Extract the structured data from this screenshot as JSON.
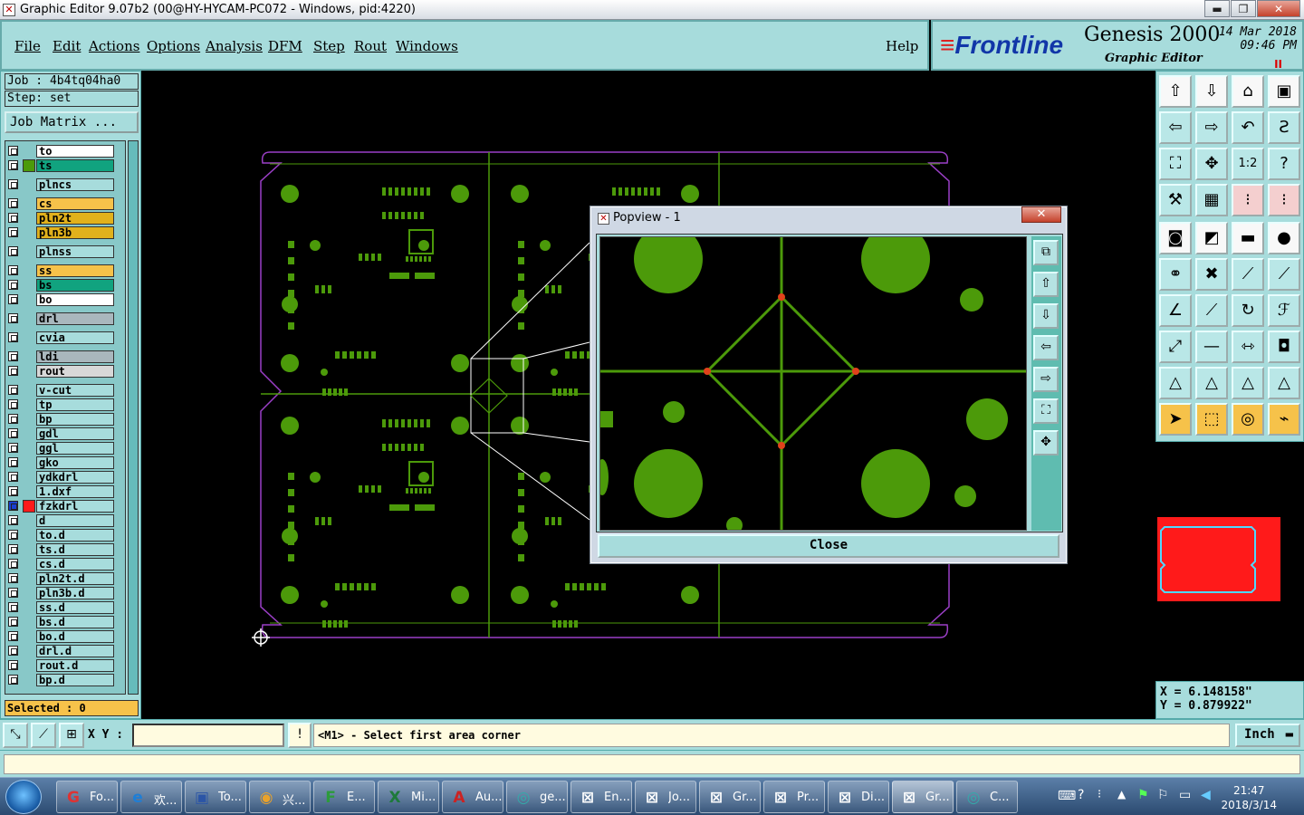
{
  "titlebar": {
    "title": "Graphic Editor 9.07b2 (00@HY-HYCAM-PC072 - Windows, pid:4220)",
    "min": "▬",
    "max": "❐",
    "close": "✕"
  },
  "menu": [
    "File",
    "Edit",
    "Actions",
    "Options",
    "Analysis",
    "DFM",
    "Step",
    "Rout",
    "Windows"
  ],
  "help_label": "Help",
  "brand": {
    "logo": "Frontline",
    "product": "Genesis 2000",
    "subtitle": "Graphic Editor",
    "date": "14 Mar 2018",
    "time": "09:46 PM",
    "pause": "II"
  },
  "job": "Job : 4b4tq04ha0",
  "step": "Step: set",
  "job_matrix": "Job Matrix ...",
  "layers": [
    {
      "name": "to",
      "color": "#ffffff"
    },
    {
      "name": "ts",
      "color": "#11a37f"
    },
    {
      "name": "plncs",
      "color": "#a7dcdc"
    },
    {
      "name": "cs",
      "color": "#f6c24a"
    },
    {
      "name": "pln2t",
      "color": "#e1b11c"
    },
    {
      "name": "pln3b",
      "color": "#e1b11c"
    },
    {
      "name": "plnss",
      "color": "#a7dcdc"
    },
    {
      "name": "ss",
      "color": "#f6c24a"
    },
    {
      "name": "bs",
      "color": "#11a37f"
    },
    {
      "name": "bo",
      "color": "#ffffff"
    },
    {
      "name": "drl",
      "color": "#a9b7bd"
    },
    {
      "name": "cvia",
      "color": "#a7dcdc"
    },
    {
      "name": "ldi",
      "color": "#a9b7bd"
    },
    {
      "name": "rout",
      "color": "#d8d8d8"
    },
    {
      "name": "v-cut",
      "color": "#a7dcdc"
    },
    {
      "name": "tp",
      "color": "#a7dcdc"
    },
    {
      "name": "bp",
      "color": "#a7dcdc"
    },
    {
      "name": "gdl",
      "color": "#a7dcdc"
    },
    {
      "name": "ggl",
      "color": "#a7dcdc"
    },
    {
      "name": "gko",
      "color": "#a7dcdc"
    },
    {
      "name": "ydkdrl",
      "color": "#a7dcdc"
    },
    {
      "name": "1.dxf",
      "color": "#a7dcdc"
    },
    {
      "name": "fzkdrl",
      "color": "#a7dcdc"
    },
    {
      "name": "d",
      "color": "#a7dcdc"
    },
    {
      "name": "to.d",
      "color": "#a7dcdc"
    },
    {
      "name": "ts.d",
      "color": "#a7dcdc"
    },
    {
      "name": "cs.d",
      "color": "#a7dcdc"
    },
    {
      "name": "pln2t.d",
      "color": "#a7dcdc"
    },
    {
      "name": "pln3b.d",
      "color": "#a7dcdc"
    },
    {
      "name": "ss.d",
      "color": "#a7dcdc"
    },
    {
      "name": "bs.d",
      "color": "#a7dcdc"
    },
    {
      "name": "bo.d",
      "color": "#a7dcdc"
    },
    {
      "name": "drl.d",
      "color": "#a7dcdc"
    },
    {
      "name": "rout.d",
      "color": "#a7dcdc"
    },
    {
      "name": "bp.d",
      "color": "#a7dcdc"
    }
  ],
  "selected": "Selected : 0",
  "popview": {
    "title": "Popview - 1",
    "close_x": "✕",
    "close_button": "Close"
  },
  "coords": {
    "x": "X = 6.148158\"",
    "y": "Y = 0.879922\""
  },
  "cmd": {
    "xy_label": "X Y :",
    "xy_value": "",
    "prompt": "<M1> - Select first area corner",
    "units": "Inch"
  },
  "taskbar": {
    "tasks": [
      {
        "label": "Fo...",
        "icon": "G",
        "color": "#d33"
      },
      {
        "label": "欢...",
        "icon": "e",
        "color": "#1e7ed6"
      },
      {
        "label": "To...",
        "icon": "▣",
        "color": "#2b55a6"
      },
      {
        "label": "兴...",
        "icon": "◉",
        "color": "#e9a22b"
      },
      {
        "label": "E...",
        "icon": "F",
        "color": "#2c9b3b"
      },
      {
        "label": "Mi...",
        "icon": "X",
        "color": "#1d7a3a"
      },
      {
        "label": "Au...",
        "icon": "A",
        "color": "#c22"
      },
      {
        "label": "ge...",
        "icon": "◎",
        "color": "#3aa"
      },
      {
        "label": "En...",
        "icon": "⊠",
        "color": "#fff"
      },
      {
        "label": "Jo...",
        "icon": "⊠",
        "color": "#fff"
      },
      {
        "label": "Gr...",
        "icon": "⊠",
        "color": "#fff"
      },
      {
        "label": "Pr...",
        "icon": "⊠",
        "color": "#fff"
      },
      {
        "label": "Di...",
        "icon": "⊠",
        "color": "#fff"
      },
      {
        "label": "Gr...",
        "icon": "⊠",
        "color": "#fff"
      },
      {
        "label": "C...",
        "icon": "◎",
        "color": "#3aa"
      }
    ],
    "time": "21:47",
    "date": "2018/3/14"
  },
  "colors": {
    "panel": "#a7dcdc",
    "pcb_green": "#4c9a0a",
    "outline_purple": "#9b3fc7",
    "minimap_red": "#ff1a1a"
  }
}
